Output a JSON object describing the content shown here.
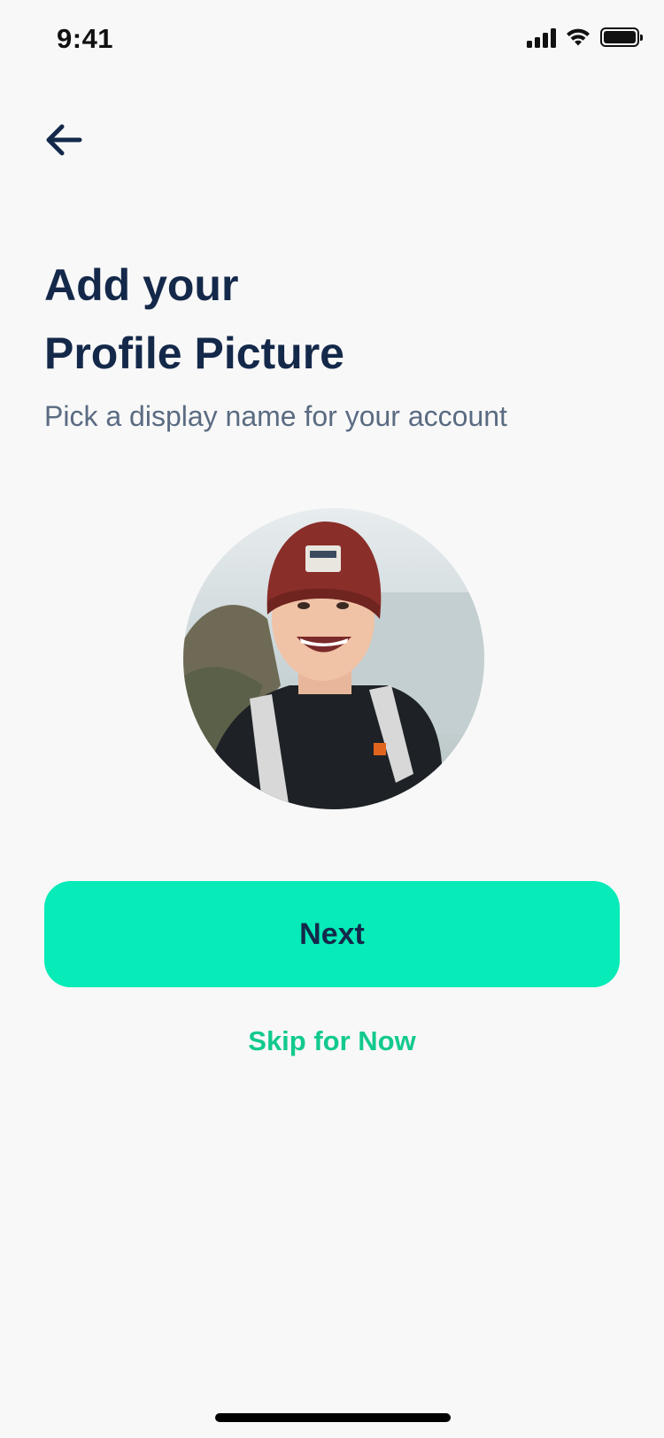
{
  "status_bar": {
    "time": "9:41"
  },
  "header": {
    "back_icon": "arrow-left-icon"
  },
  "content": {
    "title_line1": "Add your",
    "title_line2": "Profile Picture",
    "subtitle": "Pick a display name for your account"
  },
  "avatar": {
    "description_icon": "profile-photo"
  },
  "actions": {
    "next_label": "Next",
    "skip_label": "Skip for Now"
  },
  "colors": {
    "background": "#F8F8F8",
    "title": "#14294A",
    "subtitle": "#5A6B82",
    "primary_button": "#06EBB8",
    "skip_link": "#12C98E"
  }
}
